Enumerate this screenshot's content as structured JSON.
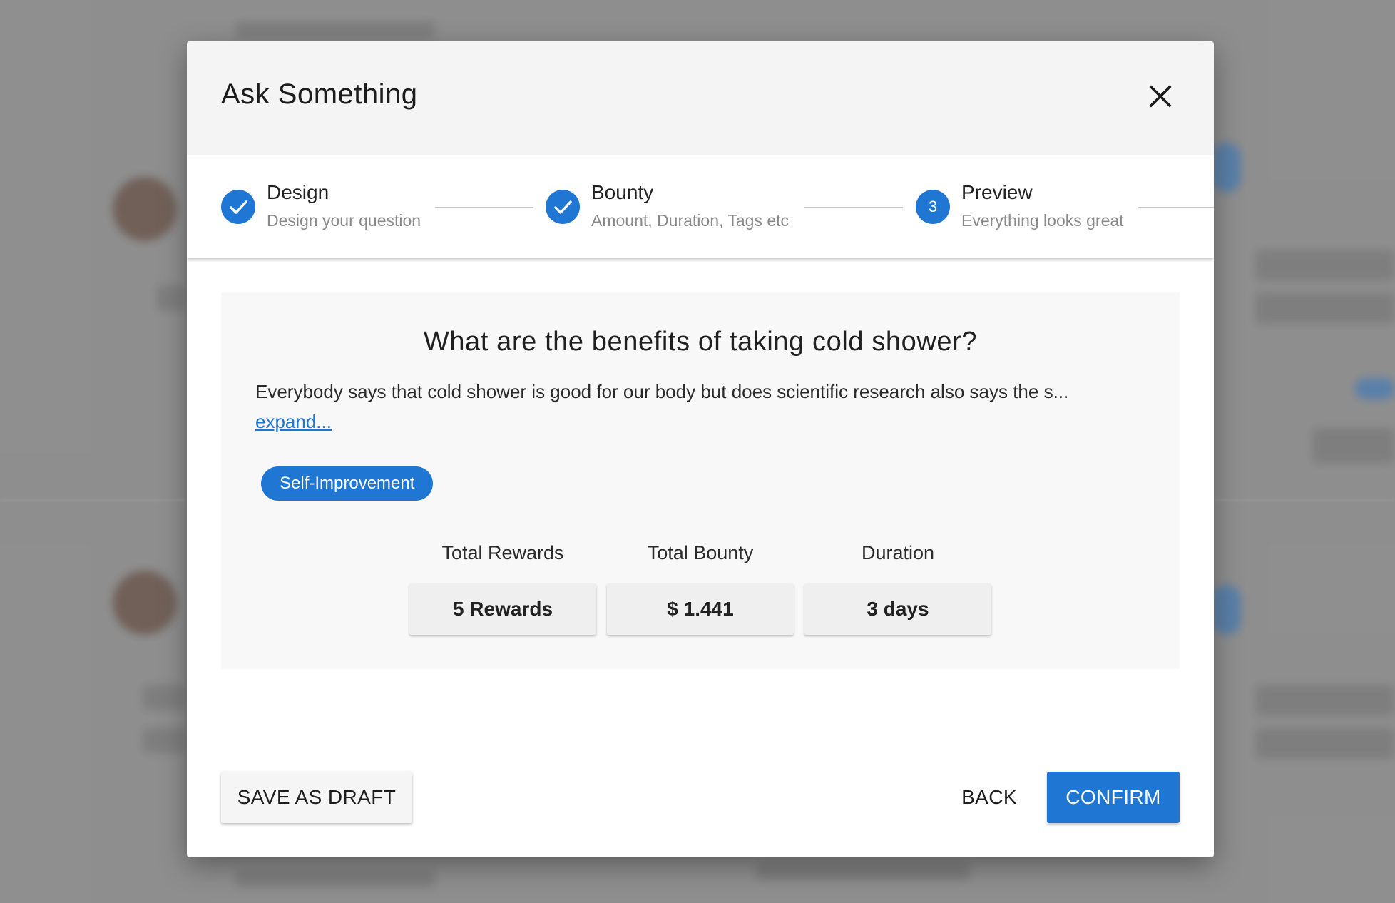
{
  "dialog": {
    "title": "Ask Something",
    "close_icon": "close-icon"
  },
  "stepper": {
    "steps": [
      {
        "label": "Design",
        "sublabel": "Design your question",
        "status": "completed",
        "icon": "check-icon"
      },
      {
        "label": "Bounty",
        "sublabel": "Amount, Duration, Tags etc",
        "status": "completed",
        "icon": "check-icon"
      },
      {
        "label": "Preview",
        "sublabel": "Everything looks great",
        "status": "active",
        "number": "3"
      }
    ]
  },
  "preview": {
    "question_title": "What are the benefits of taking cold shower?",
    "question_body": "Everybody says that cold shower is good for our body but does scientific research also says the s...",
    "expand_label": "expand...",
    "tag": "Self-Improvement",
    "stats": [
      {
        "label": "Total Rewards",
        "value": "5 Rewards"
      },
      {
        "label": "Total Bounty",
        "value": "$ 1.441"
      },
      {
        "label": "Duration",
        "value": "3 days"
      }
    ]
  },
  "footer": {
    "save_draft_label": "SAVE AS DRAFT",
    "back_label": "BACK",
    "confirm_label": "CONFIRM"
  },
  "colors": {
    "accent": "#1f77d3",
    "header_bg": "#f4f4f4",
    "card_bg": "#f8f8f8"
  }
}
